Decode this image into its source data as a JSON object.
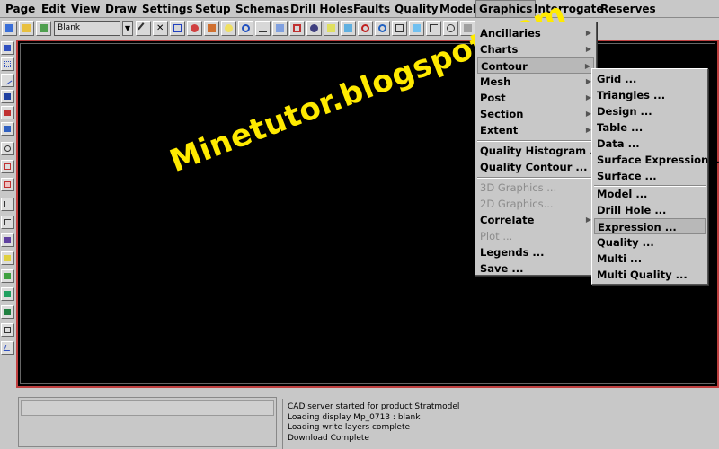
{
  "menubar": {
    "items": [
      "Page",
      "Edit",
      "View",
      "Draw",
      "Settings",
      "Setup",
      "Schemas",
      "Drill Holes",
      "Faults",
      "Quality",
      "Model",
      "Graphics",
      "Interrogate",
      "Reserves"
    ],
    "active": "Graphics"
  },
  "toolbar": {
    "layer_combo_value": "Blank",
    "icons": [
      "layers-icon",
      "open-icon",
      "layer-list-icon",
      "pencil-icon",
      "cross-icon",
      "select-icon",
      "erase-icon",
      "label-icon",
      "lamp-icon",
      "link-icon",
      "measure-icon",
      "grid-icon",
      "zoom-window-icon",
      "eye-icon",
      "fit-icon",
      "pan-icon",
      "refresh-icon",
      "zoom-in-icon",
      "zoom-out-icon",
      "window-icon",
      "split-icon",
      "pan-icon-2",
      "section-icon"
    ]
  },
  "left_tools": [
    "text-tool-icon",
    "point-tool-icon",
    "line-tool-icon",
    "fill-tool-icon",
    "arrow-tool-icon",
    "move-tool-icon",
    "symbol-tool-icon",
    "rect-tool-icon",
    "box-tool-icon",
    "stair-tool-icon",
    "step-tool-icon",
    "chart-tool-icon",
    "grid-tool-icon",
    "pattern-tool-icon",
    "table-tool-icon",
    "color-tool-icon",
    "sheet-tool-icon",
    "angle-tool-icon"
  ],
  "graphics_menu": {
    "items": [
      {
        "label": "Ancillaries",
        "submenu": true,
        "disabled": false
      },
      {
        "label": "Charts",
        "submenu": true,
        "disabled": false
      },
      {
        "label": "Contour",
        "submenu": true,
        "disabled": false,
        "highlight": true
      },
      {
        "label": "Mesh",
        "submenu": true,
        "disabled": false
      },
      {
        "label": "Post",
        "submenu": true,
        "disabled": false
      },
      {
        "label": "Section",
        "submenu": true,
        "disabled": false
      },
      {
        "label": "Extent",
        "submenu": true,
        "disabled": false
      },
      {
        "label": "Quality Histogram ...",
        "submenu": false,
        "disabled": false
      },
      {
        "label": "Quality Contour ...",
        "submenu": false,
        "disabled": false
      },
      {
        "label": "3D Graphics ...",
        "submenu": false,
        "disabled": true
      },
      {
        "label": "2D Graphics...",
        "submenu": false,
        "disabled": true
      },
      {
        "label": "Correlate",
        "submenu": true,
        "disabled": false
      },
      {
        "label": "Plot ...",
        "submenu": false,
        "disabled": true
      },
      {
        "label": "Legends ...",
        "submenu": false,
        "disabled": false
      },
      {
        "label": "Save ...",
        "submenu": false,
        "disabled": false
      }
    ]
  },
  "contour_submenu": {
    "items": [
      {
        "label": "Grid ...",
        "highlight": false
      },
      {
        "label": "Triangles ...",
        "highlight": false
      },
      {
        "label": "Design ...",
        "highlight": false
      },
      {
        "label": "Table ...",
        "highlight": false
      },
      {
        "label": "Data ...",
        "highlight": false
      },
      {
        "label": "Surface Expression ...",
        "highlight": false
      },
      {
        "label": "Surface ...",
        "highlight": false
      },
      {
        "label": "Model ...",
        "highlight": false
      },
      {
        "label": "Drill Hole ...",
        "highlight": false
      },
      {
        "label": "Expression ...",
        "highlight": true
      },
      {
        "label": "Quality ...",
        "highlight": false
      },
      {
        "label": "Multi ...",
        "highlight": false
      },
      {
        "label": "Multi Quality ...",
        "highlight": false
      }
    ]
  },
  "watermark": {
    "text": "Minetutor.blogspot.com",
    "color": "#ffea00"
  },
  "console": {
    "lines": [
      "CAD server started for product Stratmodel",
      "Loading display Mp_0713 : blank",
      "Loading write layers complete",
      "Download Complete"
    ]
  },
  "colors": {
    "canvas": "#000000",
    "canvas_border": "#c04040",
    "chrome": "#c8c8c8"
  }
}
